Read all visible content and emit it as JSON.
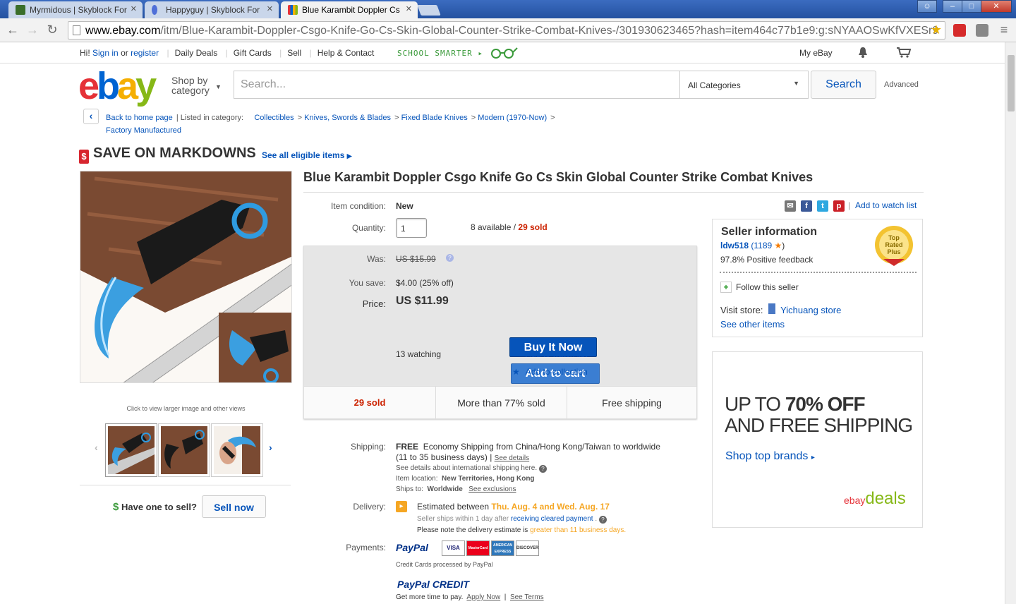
{
  "browser": {
    "tabs": [
      {
        "label": "Myrmidous | Skyblock For",
        "active": false
      },
      {
        "label": "Happyguy | Skyblock For",
        "active": false
      },
      {
        "label": "Blue Karambit Doppler Cs",
        "active": true
      }
    ],
    "url_domain": "www.ebay.com",
    "url_rest": "/itm/Blue-Karambit-Doppler-Csgo-Knife-Go-Cs-Skin-Global-Counter-Strike-Combat-Knives-/301930623465?hash=item464c77b1e9:g:sNYAAOSwKfVXESr9"
  },
  "global_header": {
    "greeting": "Hi!",
    "sign_in": "Sign in",
    "or": "or",
    "register": "register",
    "links": [
      "Daily Deals",
      "Gift Cards",
      "Sell",
      "Help & Contact"
    ],
    "promo": "SCHOOL SMARTER",
    "my_ebay": "My eBay"
  },
  "search": {
    "shop_by": "Shop by",
    "category": "category",
    "placeholder": "Search...",
    "category_select": "All Categories",
    "button": "Search",
    "advanced": "Advanced"
  },
  "breadcrumb": {
    "back": "Back to home page",
    "listed_in": "Listed in category:",
    "items": [
      "Collectibles",
      "Knives, Swords & Blades",
      "Fixed Blade Knives",
      "Modern (1970-Now)",
      "Factory Manufactured"
    ]
  },
  "markdowns": {
    "title": "SAVE ON MARKDOWNS",
    "link": "See all eligible items"
  },
  "gallery": {
    "caption": "Click to view larger image and other views"
  },
  "sell": {
    "question": "Have one to sell?",
    "button": "Sell now"
  },
  "item": {
    "title": "Blue Karambit Doppler Csgo Knife Go Cs Skin Global Counter Strike Combat Knives",
    "condition_label": "Item condition:",
    "condition": "New",
    "quantity_label": "Quantity:",
    "quantity": "1",
    "available": "8 available /",
    "sold": "29 sold",
    "was_label": "Was:",
    "was": "US $15.99",
    "save_label": "You save:",
    "save": "$4.00 (25% off)",
    "price_label": "Price:",
    "price": "US $11.99",
    "buy_now": "Buy It Now",
    "add_cart": "Add to cart",
    "watching": "13 watching",
    "add_watch": "Add to watch list",
    "add_collection": "Add to collection",
    "stats": [
      "29 sold",
      "More than 77% sold",
      "Free shipping"
    ]
  },
  "shipping": {
    "label": "Shipping:",
    "free": "FREE",
    "desc": "Economy Shipping from China/Hong Kong/Taiwan to worldwide",
    "days": "(11 to 35 business days)",
    "see_details": "See details",
    "intl": "See details about international shipping here.",
    "location_label": "Item location:",
    "location": "New Territories, Hong Kong",
    "ships_label": "Ships to:",
    "ships": "Worldwide",
    "exclusions": "See exclusions"
  },
  "delivery": {
    "label": "Delivery:",
    "estimated": "Estimated between",
    "dates": "Thu. Aug. 4 and Wed. Aug. 17",
    "ships_within": "Seller ships within 1 day after",
    "cleared": "receiving cleared payment",
    "note": "Please note the delivery estimate is",
    "note_hl": "greater than 11 business days."
  },
  "payments": {
    "label": "Payments:",
    "paypal": "PayPal",
    "cards": [
      "VISA",
      "MasterCard",
      "AMERICAN EXPRESS",
      "DISCOVER"
    ],
    "cc_note": "Credit Cards processed by PayPal",
    "credit": "PayPal CREDIT",
    "credit_note": "Get more time to pay.",
    "apply": "Apply Now",
    "terms": "See Terms"
  },
  "watch_list_top": "Add to watch list",
  "seller": {
    "heading": "Seller information",
    "name": "ldw518",
    "score": "(1189",
    "feedback": "97.8% Positive feedback",
    "badge": "Top Rated Plus",
    "follow": "Follow this seller",
    "visit": "Visit store:",
    "store": "Yichuang store",
    "other": "See other items"
  },
  "ad": {
    "line1a": "UP TO ",
    "line1b": "70% OFF",
    "line2": "AND FREE SHIPPING",
    "link": "Shop top brands",
    "brand_ebay": "ebay",
    "brand_deals": "deals"
  },
  "colors": {
    "ebay_blue": "#0654ba",
    "sold_red": "#cc2200",
    "delivery_orange": "#f5a623"
  }
}
